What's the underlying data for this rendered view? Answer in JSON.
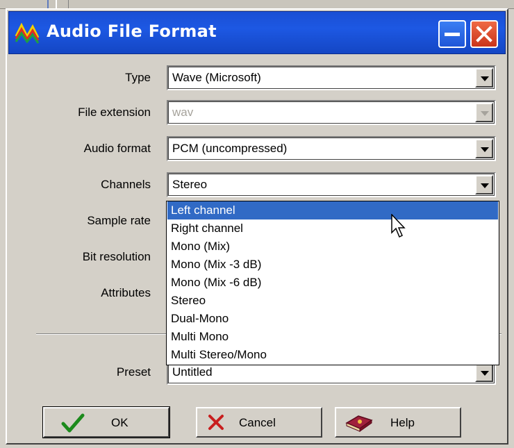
{
  "dialog": {
    "title": "Audio File Format",
    "title_icon": "waveform-icon",
    "minimize_icon": "minimize-icon",
    "close_icon": "close-icon"
  },
  "fields": {
    "type": {
      "label": "Type",
      "value": "Wave (Microsoft)"
    },
    "file_extension": {
      "label": "File extension",
      "value": "wav"
    },
    "audio_format": {
      "label": "Audio format",
      "value": "PCM (uncompressed)"
    },
    "channels": {
      "label": "Channels",
      "value": "Stereo"
    },
    "sample_rate": {
      "label": "Sample rate"
    },
    "bit_resolution": {
      "label": "Bit resolution"
    },
    "attributes": {
      "label": "Attributes"
    },
    "preset": {
      "label": "Preset",
      "value": "Untitled"
    }
  },
  "channels_dropdown": {
    "selected_index": 0,
    "options": [
      "Left channel",
      "Right channel",
      "Mono (Mix)",
      "Mono (Mix -3 dB)",
      "Mono (Mix -6 dB)",
      "Stereo",
      "Dual-Mono",
      "Multi Mono",
      "Multi Stereo/Mono"
    ]
  },
  "buttons": {
    "ok": {
      "label": "OK",
      "icon": "checkmark-icon"
    },
    "cancel": {
      "label": "Cancel",
      "icon": "x-mark-icon"
    },
    "help": {
      "label": "Help",
      "icon": "help-book-icon"
    }
  },
  "colors": {
    "title_bar": "#1d58e3",
    "selection": "#316ac5",
    "dialog_bg": "#d4d0c8"
  }
}
